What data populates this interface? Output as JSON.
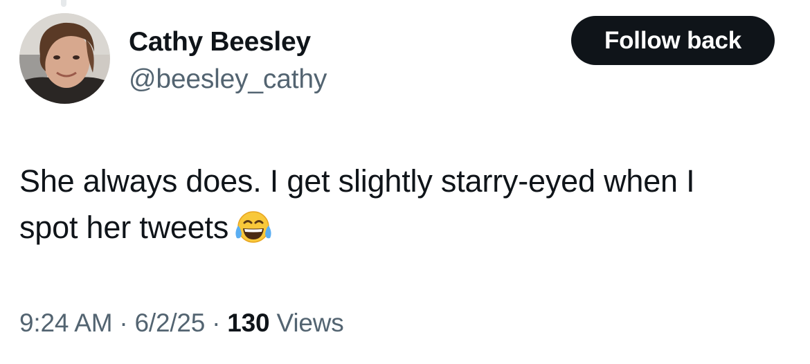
{
  "author": {
    "display_name": "Cathy Beesley",
    "handle": "@beesley_cathy"
  },
  "follow_button": {
    "label": "Follow back"
  },
  "tweet": {
    "text_line_1": "She always does. I get slightly starry-eyed when I",
    "text_line_2": "spot her tweets",
    "emoji": "face-with-tears-of-joy"
  },
  "meta": {
    "time": "9:24 AM",
    "separator": "·",
    "date": "6/2/25",
    "views_count": "130",
    "views_label": "Views"
  },
  "colors": {
    "text_primary": "#0f1419",
    "text_secondary": "#536471",
    "button_bg": "#0f1419",
    "button_text": "#ffffff"
  }
}
